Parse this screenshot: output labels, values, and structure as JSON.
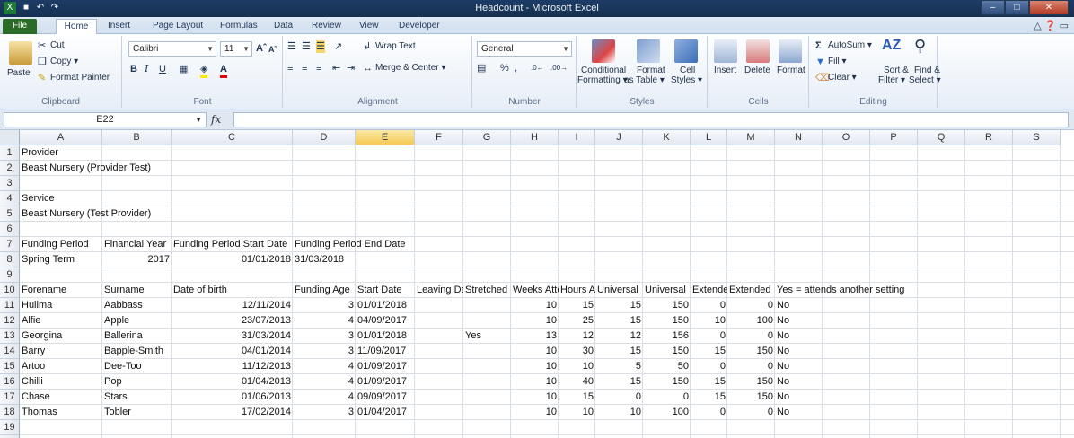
{
  "window": {
    "title": "Headcount - Microsoft Excel",
    "minimize": "–",
    "maximize": "□",
    "close": "✕"
  },
  "tabs": [
    "File",
    "Home",
    "Insert",
    "Page Layout",
    "Formulas",
    "Data",
    "Review",
    "View",
    "Developer"
  ],
  "ribbon": {
    "clipboard": {
      "paste": "Paste",
      "cut": "Cut",
      "copy": "Copy ▾",
      "format_painter": "Format Painter",
      "label": "Clipboard"
    },
    "font": {
      "name": "Calibri",
      "size": "11",
      "label": "Font"
    },
    "alignment": {
      "wrap": "Wrap Text",
      "merge": "Merge & Center ▾",
      "label": "Alignment"
    },
    "number": {
      "format": "General",
      "label": "Number"
    },
    "styles": {
      "conditional": "Conditional",
      "conditional2": "Formatting ▾",
      "format_table": "Format",
      "format_table2": "as Table ▾",
      "cell_styles": "Cell",
      "cell_styles2": "Styles ▾",
      "label": "Styles"
    },
    "cells": {
      "insert": "Insert",
      "delete": "Delete",
      "format": "Format",
      "label": "Cells"
    },
    "editing": {
      "autosum": "AutoSum ▾",
      "fill": "Fill ▾",
      "clear": "Clear ▾",
      "sort": "Sort &",
      "sort2": "Filter ▾",
      "find": "Find &",
      "find2": "Select ▾",
      "label": "Editing"
    }
  },
  "formula_bar": {
    "name_box": "E22",
    "fx": "fx",
    "formula": ""
  },
  "sheet": {
    "columns": [
      "A",
      "B",
      "C",
      "D",
      "E",
      "F",
      "G",
      "H",
      "I",
      "J",
      "K",
      "L",
      "M",
      "N",
      "O",
      "P",
      "Q",
      "R",
      "S"
    ],
    "selected_column": "E",
    "rows": [
      "1",
      "2",
      "3",
      "4",
      "5",
      "6",
      "7",
      "8",
      "9",
      "10",
      "11",
      "12",
      "13",
      "14",
      "15",
      "16",
      "17",
      "18",
      "19",
      "20"
    ],
    "cells": {
      "r1": {
        "A": "Provider"
      },
      "r2": {
        "A": "Beast Nursery (Provider Test)"
      },
      "r4": {
        "A": "Service"
      },
      "r5": {
        "A": "Beast Nursery (Test Provider)"
      },
      "r7": {
        "A": "Funding Period",
        "B": "Financial Year",
        "C": "Funding Period Start Date",
        "D": "Funding Period End Date"
      },
      "r8": {
        "A": "Spring Term",
        "B": "2017",
        "C": "01/01/2018",
        "D": "31/03/2018"
      },
      "r10": {
        "A": "Forename",
        "B": "Surname",
        "C": "Date of birth",
        "D": "Funding Age",
        "E": "Start Date",
        "F": "Leaving Date",
        "G": "Stretched",
        "H": "Weeks Attended",
        "I": "Hours Attended",
        "J": "Universal",
        "K": "Universal",
        "L": "Extended",
        "M": "Extended",
        "N": "Yes = attends another setting"
      }
    },
    "children": [
      {
        "forename": "Hulima",
        "surname": "Aabbass",
        "dob": "12/11/2014",
        "age": "3",
        "start": "01/01/2018",
        "stretched": "",
        "weeks": "10",
        "hours": "15",
        "u1": "15",
        "u2": "150",
        "e1": "0",
        "e2": "0",
        "other": "No"
      },
      {
        "forename": "Alfie",
        "surname": "Apple",
        "dob": "23/07/2013",
        "age": "4",
        "start": "04/09/2017",
        "stretched": "",
        "weeks": "10",
        "hours": "25",
        "u1": "15",
        "u2": "150",
        "e1": "10",
        "e2": "100",
        "other": "No"
      },
      {
        "forename": "Georgina",
        "surname": "Ballerina",
        "dob": "31/03/2014",
        "age": "3",
        "start": "01/01/2018",
        "stretched": "Yes",
        "weeks": "13",
        "hours": "12",
        "u1": "12",
        "u2": "156",
        "e1": "0",
        "e2": "0",
        "other": "No"
      },
      {
        "forename": "Barry",
        "surname": "Bapple-Smith",
        "dob": "04/01/2014",
        "age": "3",
        "start": "11/09/2017",
        "stretched": "",
        "weeks": "10",
        "hours": "30",
        "u1": "15",
        "u2": "150",
        "e1": "15",
        "e2": "150",
        "other": "No"
      },
      {
        "forename": "Artoo",
        "surname": "Dee-Too",
        "dob": "11/12/2013",
        "age": "4",
        "start": "01/09/2017",
        "stretched": "",
        "weeks": "10",
        "hours": "10",
        "u1": "5",
        "u2": "50",
        "e1": "0",
        "e2": "0",
        "other": "No"
      },
      {
        "forename": "Chilli",
        "surname": "Pop",
        "dob": "01/04/2013",
        "age": "4",
        "start": "01/09/2017",
        "stretched": "",
        "weeks": "10",
        "hours": "40",
        "u1": "15",
        "u2": "150",
        "e1": "15",
        "e2": "150",
        "other": "No"
      },
      {
        "forename": "Chase",
        "surname": "Stars",
        "dob": "01/06/2013",
        "age": "4",
        "start": "09/09/2017",
        "stretched": "",
        "weeks": "10",
        "hours": "15",
        "u1": "0",
        "u2": "0",
        "e1": "15",
        "e2": "150",
        "other": "No"
      },
      {
        "forename": "Thomas",
        "surname": "Tobler",
        "dob": "17/02/2014",
        "age": "3",
        "start": "01/04/2017",
        "stretched": "",
        "weeks": "10",
        "hours": "10",
        "u1": "10",
        "u2": "100",
        "e1": "0",
        "e2": "0",
        "other": "No"
      }
    ]
  },
  "colors": {
    "title_bar": "#1d3c66",
    "file_tab": "#2a6b27",
    "selected_header": "#f5c953",
    "grid_line": "#dadfe6"
  }
}
